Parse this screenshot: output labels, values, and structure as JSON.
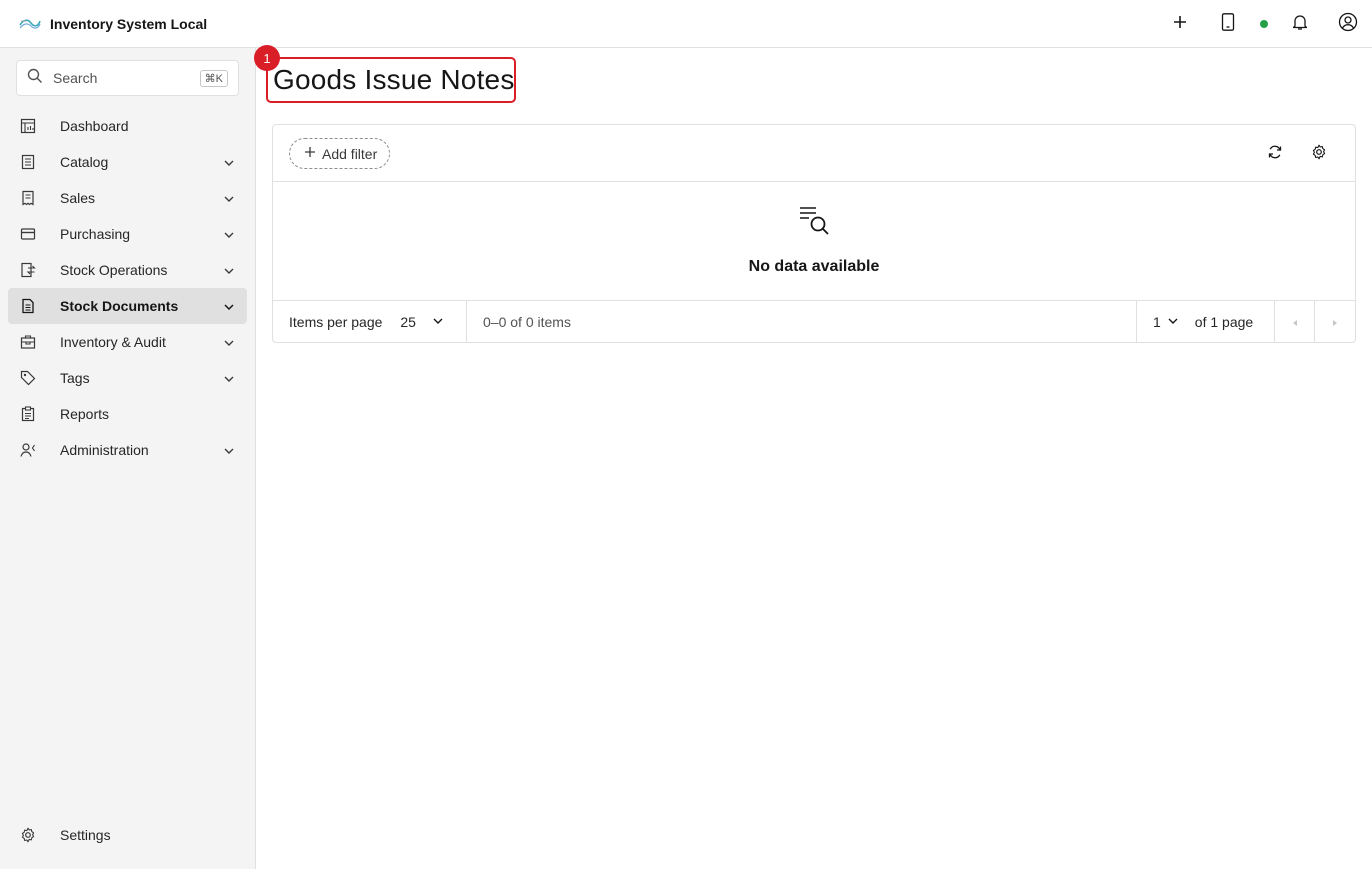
{
  "app": {
    "title": "Inventory System Local"
  },
  "header": {
    "icons": [
      "plus-icon",
      "mobile-icon",
      "status-dot",
      "bell-icon",
      "user-avatar-icon"
    ],
    "status_color": "#24a148"
  },
  "sidebar": {
    "search": {
      "placeholder": "Search",
      "shortcut": "⌘K"
    },
    "items": [
      {
        "label": "Dashboard",
        "icon": "dashboard-icon",
        "expandable": false
      },
      {
        "label": "Catalog",
        "icon": "catalog-icon",
        "expandable": true
      },
      {
        "label": "Sales",
        "icon": "receipt-icon",
        "expandable": true
      },
      {
        "label": "Purchasing",
        "icon": "card-icon",
        "expandable": true
      },
      {
        "label": "Stock Operations",
        "icon": "transfer-icon",
        "expandable": true
      },
      {
        "label": "Stock Documents",
        "icon": "document-icon",
        "expandable": true,
        "active": true
      },
      {
        "label": "Inventory & Audit",
        "icon": "inventory-icon",
        "expandable": true
      },
      {
        "label": "Tags",
        "icon": "tag-icon",
        "expandable": true
      },
      {
        "label": "Reports",
        "icon": "report-icon",
        "expandable": false
      },
      {
        "label": "Administration",
        "icon": "admin-icon",
        "expandable": true
      }
    ],
    "settings_label": "Settings"
  },
  "main": {
    "title": "Goods Issue Notes",
    "highlight_badge": "1",
    "toolbar": {
      "add_filter_label": "Add filter"
    },
    "empty": {
      "message": "No data available"
    },
    "pagination": {
      "items_per_page_label": "Items per page",
      "page_size": "25",
      "range_text": "0–0 of 0 items",
      "current_page": "1",
      "of_pages_text": "of 1 page"
    }
  },
  "colors": {
    "accent": "#da1e28",
    "sidebar_bg": "#f4f4f4",
    "active_bg": "#e0e0e0"
  }
}
